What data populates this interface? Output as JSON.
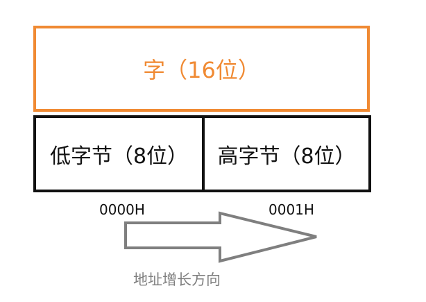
{
  "diagram": {
    "word_label": "字（16位）",
    "low_byte_label": "低字节（8位）",
    "high_byte_label": "高字节（8位）",
    "low_address": "0000H",
    "high_address": "0001H",
    "direction_label": "地址增长方向",
    "colors": {
      "word_accent": "#f08a33",
      "byte_border": "#111111",
      "arrow": "#7f7f7f"
    }
  }
}
